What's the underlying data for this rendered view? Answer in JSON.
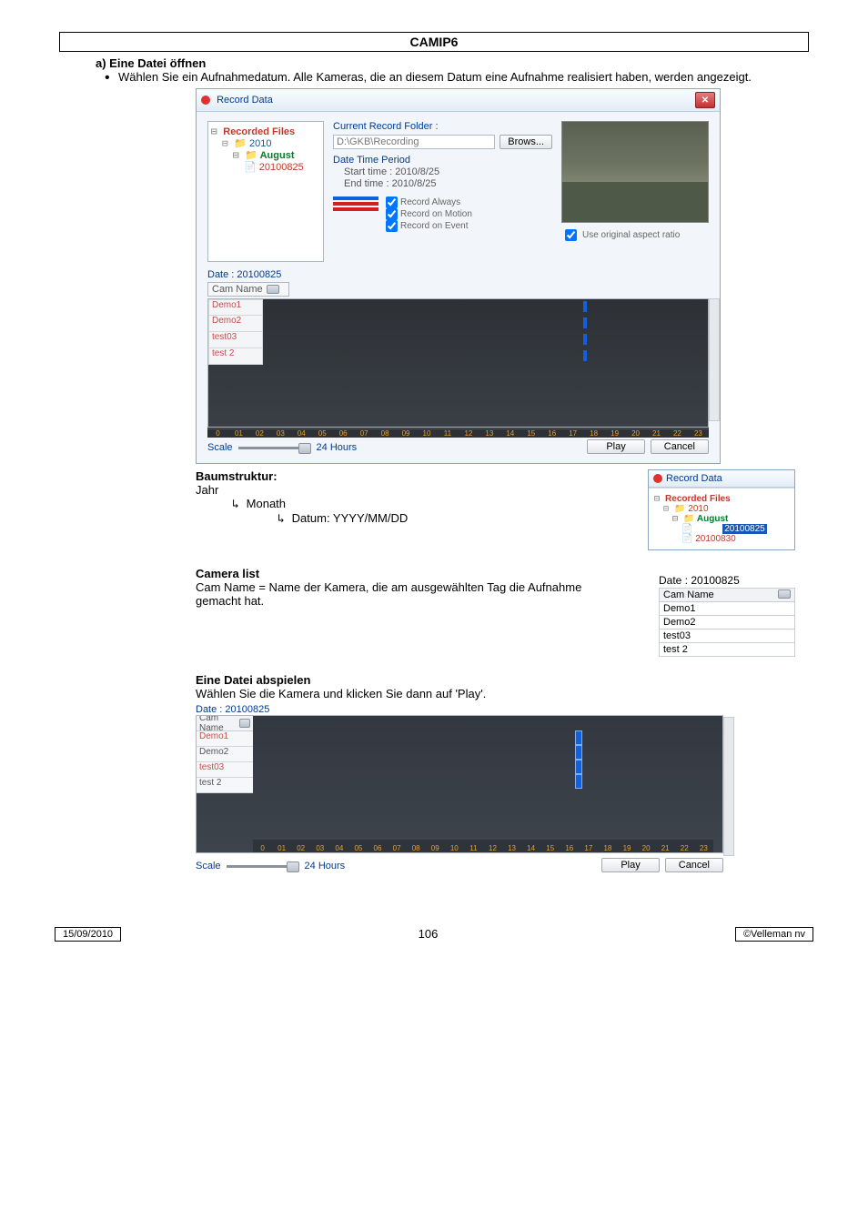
{
  "header": {
    "title": "CAMIP6"
  },
  "section_a": {
    "heading": "a) Eine Datei öffnen",
    "bullet": "Wählen Sie ein Aufnahmedatum. Alle Kameras, die an diesem Datum eine Aufnahme realisiert haben, werden angezeigt."
  },
  "dialog": {
    "title": "Record Data",
    "tree": {
      "root": "Recorded Files",
      "year": "2010",
      "month": "August",
      "date": "20100825"
    },
    "folder": {
      "label": "Current Record Folder :",
      "path": "D:\\GKB\\Recording",
      "browse": "Brows..."
    },
    "dtp": {
      "label": "Date Time Period",
      "start": "Start time : 2010/8/25",
      "end": "End time : 2010/8/25"
    },
    "legends": {
      "always": "Record Always",
      "motion": "Record on Motion",
      "event": "Record on Event"
    },
    "aspect_ratio": "Use original aspect ratio",
    "dateline": "Date : 20100825",
    "cam_header": "Cam Name",
    "cams": [
      "Demo1",
      "Demo2",
      "test03",
      "test 2"
    ],
    "hours": [
      "0",
      "01",
      "02",
      "03",
      "04",
      "05",
      "06",
      "07",
      "08",
      "09",
      "10",
      "11",
      "12",
      "13",
      "14",
      "15",
      "16",
      "17",
      "18",
      "19",
      "20",
      "21",
      "22",
      "23"
    ],
    "scale_label": "Scale",
    "scale_value": "24 Hours",
    "play": "Play",
    "cancel": "Cancel"
  },
  "baum": {
    "heading": "Baumstruktur:",
    "l1": "Jahr",
    "l2": "Monath",
    "l3": "Datum: YYYY/MM/DD"
  },
  "small_dialog": {
    "title": "Record Data",
    "root": "Recorded Files",
    "year": "2010",
    "month": "August",
    "date_sel": "20100825",
    "date2": "20100830"
  },
  "camlist": {
    "heading": "Camera list",
    "body": "Cam Name = Name der Kamera, die am ausgewählten Tag die Aufnahme gemacht hat.",
    "dateline": "Date : 20100825",
    "header": "Cam Name",
    "rows": [
      "Demo1",
      "Demo2",
      "test03",
      "test 2"
    ]
  },
  "playback": {
    "heading": "Eine Datei abspielen",
    "body": "Wählen Sie die Kamera und klicken Sie dann auf 'Play'."
  },
  "timeline2": {
    "dateline": "Date : 20100825",
    "cam_header": "Cam Name",
    "cams": [
      "Demo1",
      "Demo2",
      "test03",
      "test 2"
    ],
    "hours": [
      "0",
      "01",
      "02",
      "03",
      "04",
      "05",
      "06",
      "07",
      "08",
      "09",
      "10",
      "11",
      "12",
      "13",
      "14",
      "15",
      "16",
      "17",
      "18",
      "19",
      "20",
      "21",
      "22",
      "23"
    ],
    "scale_label": "Scale",
    "scale_value": "24 Hours",
    "play": "Play",
    "cancel": "Cancel"
  },
  "footer": {
    "date": "15/09/2010",
    "page": "106",
    "copy": "©Velleman nv"
  }
}
